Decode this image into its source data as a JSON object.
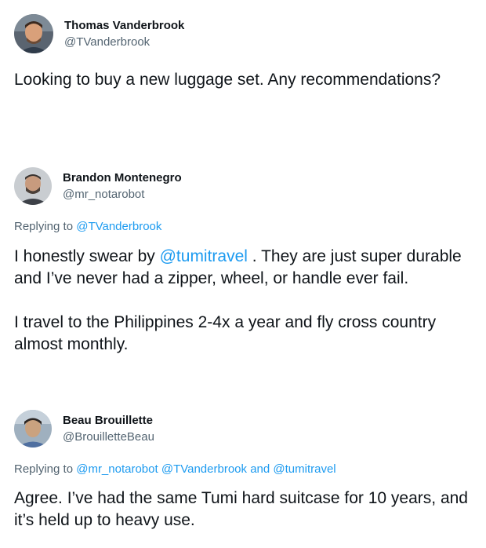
{
  "tweets": [
    {
      "author": "Thomas Vanderbrook",
      "handle": "@TVanderbrook",
      "text": "Looking to buy a new luggage set. Any recommendations?"
    },
    {
      "author": "Brandon Montenegro",
      "handle": "@mr_notarobot",
      "replying_prefix": "Replying to",
      "replying_to": "@TVanderbrook",
      "text_before_mention": "I honestly swear by",
      "text_mention": "@tumitravel",
      "text_after_mention": ". They are just super durable and I’ve never had a zipper, wheel, or handle ever fail.",
      "text_paragraph_2": "I travel to the Philippines 2-4x a year and fly cross country almost monthly."
    },
    {
      "author": "Beau Brouillette",
      "handle": "@BrouilletteBeau",
      "replying_prefix": "Replying to",
      "replying_to_1": "@mr_notarobot",
      "replying_to_2": "@TVanderbrook",
      "replying_and": "and",
      "replying_to_3": "@tumitravel",
      "text": "Agree.  I’ve had the same Tumi hard suitcase for 10 years, and it’s held up to heavy use."
    }
  ],
  "colors": {
    "text": "#0f1419",
    "secondary": "#536471",
    "link": "#1d9bf0"
  }
}
